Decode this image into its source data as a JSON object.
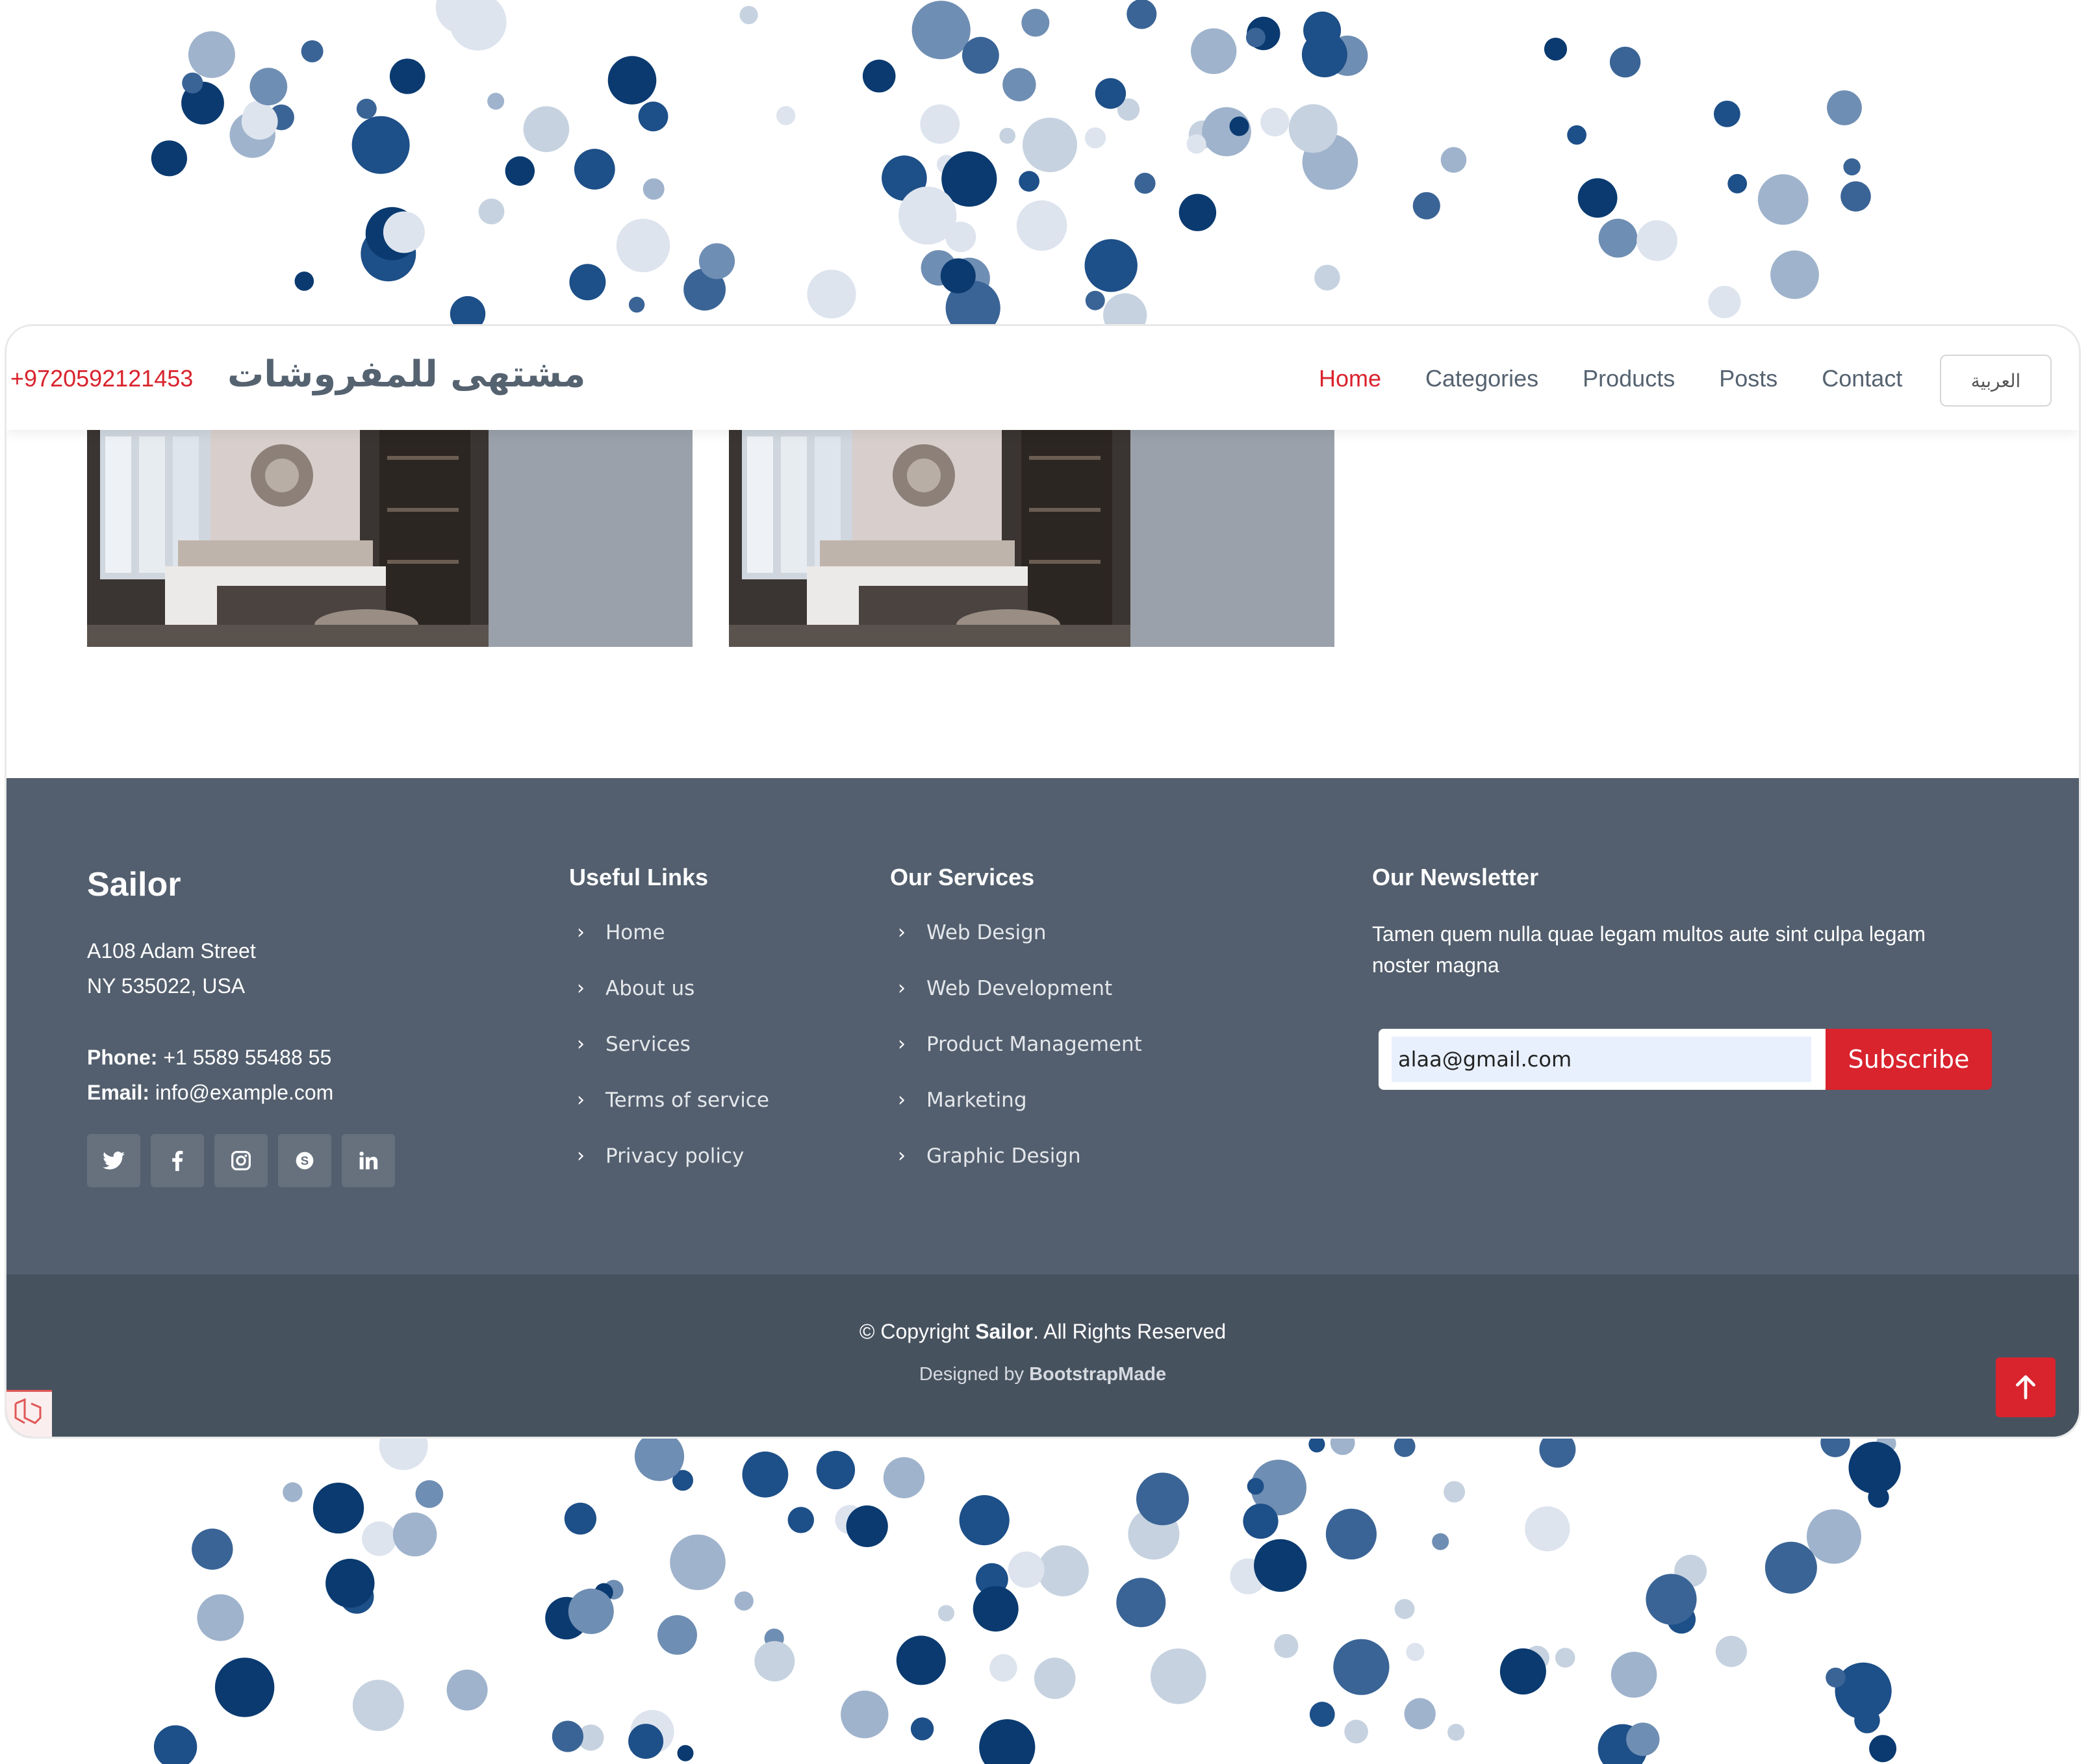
{
  "header": {
    "phone": "+9720592121453",
    "brand": "مشتهى للمفروشات",
    "nav": [
      "Home",
      "Categories",
      "Products",
      "Posts",
      "Contact"
    ],
    "active_nav": "Home",
    "language": "العربية"
  },
  "footer": {
    "brand": "Sailor",
    "address_line1": "A108 Adam Street",
    "address_line2": "NY 535022, USA",
    "phone_label": "Phone:",
    "phone_value": "+1 5589 55488 55",
    "email_label": "Email:",
    "email_value": "info@example.com",
    "social": [
      "twitter-icon",
      "facebook-icon",
      "instagram-icon",
      "skype-icon",
      "linkedin-icon"
    ],
    "useful_links_title": "Useful Links",
    "useful_links": [
      "Home",
      "About us",
      "Services",
      "Terms of service",
      "Privacy policy"
    ],
    "services_title": "Our Services",
    "services": [
      "Web Design",
      "Web Development",
      "Product Management",
      "Marketing",
      "Graphic Design"
    ],
    "newsletter_title": "Our Newsletter",
    "newsletter_text_line1": "Tamen quem nulla quae legam multos aute sint culpa legam",
    "newsletter_text_line2": "noster magna",
    "newsletter_email": "alaa@gmail.com",
    "subscribe_label": "Subscribe",
    "copyright_prefix": "© Copyright",
    "copyright_brand": "Sailor",
    "copyright_suffix": ". All Rights Reserved",
    "designed_prefix": "Designed by",
    "designed_brand": "BootstrapMade"
  },
  "colors": {
    "accent": "#d9232d",
    "footer_top": "#535f6e",
    "footer_bottom": "#47525f",
    "text_muted": "#556270"
  }
}
